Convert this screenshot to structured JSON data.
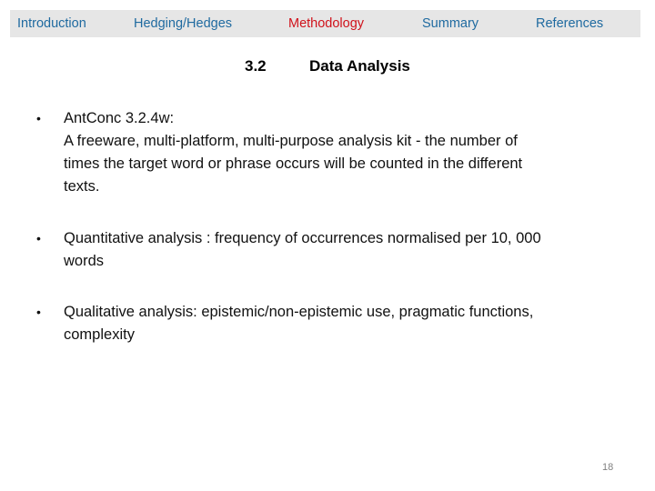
{
  "nav": {
    "items": [
      {
        "label": "Introduction",
        "active": false
      },
      {
        "label": "Hedging/Hedges",
        "active": false
      },
      {
        "label": "Methodology",
        "active": true
      },
      {
        "label": "Summary",
        "active": false
      },
      {
        "label": "References",
        "active": false
      }
    ],
    "colors": {
      "background": "#e6e6e6",
      "default_text": "#1f6aa0",
      "active_text": "#d0121b"
    }
  },
  "slide": {
    "section_number": "3.2",
    "title": "Data Analysis",
    "bullets": [
      {
        "marker": "•",
        "lines": [
          "AntConc  3.2.4w:",
          "A freeware, multi-platform, multi-purpose analysis kit  - the number  of",
          "times the target word or phrase occurs will be counted in the different",
          "texts."
        ]
      },
      {
        "marker": "•",
        "lines": [
          "Quantitative analysis : frequency of occurrences normalised per 10, 000",
          "words"
        ]
      },
      {
        "marker": "•",
        "lines": [
          "Qualitative analysis: epistemic/non-epistemic use, pragmatic functions,",
          "complexity"
        ]
      }
    ],
    "page_number": "18"
  }
}
